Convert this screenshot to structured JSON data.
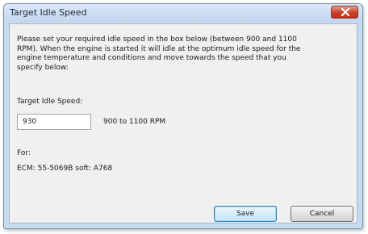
{
  "window": {
    "title": "Target Idle Speed"
  },
  "dialog": {
    "description": "Please set your required idle speed in the box below (between 900 and 1100\nRPM). When the engine is started it will idle at the optimum idle speed for the\nengine temperature and conditions and move towards the speed that you\nspecify below:",
    "speed_label": "Target Idle Speed:",
    "speed_value": "930",
    "range_hint": "900 to 1100 RPM",
    "for_label": "For:",
    "ecm_info": "ECM: 55-5069B soft: A768"
  },
  "buttons": {
    "save_label": "Save",
    "cancel_label": "Cancel"
  },
  "icons": {
    "close": "close-icon"
  },
  "colors": {
    "close_button": "#c9402a",
    "title_bar": "#c3d7ef",
    "default_button_border": "#3c7fb1"
  }
}
